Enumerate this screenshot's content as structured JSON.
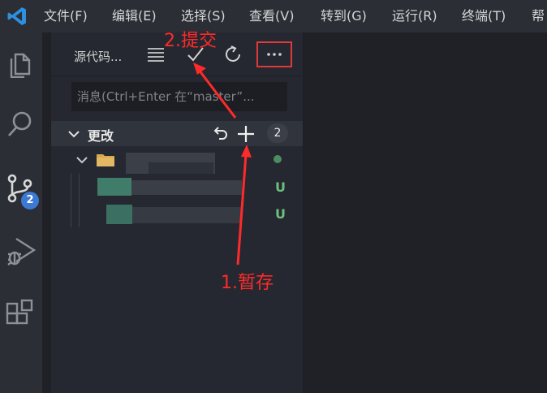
{
  "menu": [
    "文件(F)",
    "编辑(E)",
    "选择(S)",
    "查看(V)",
    "转到(G)",
    "运行(R)",
    "终端(T)",
    "帮"
  ],
  "activity": {
    "source_control_badge": "2"
  },
  "sidebar": {
    "title": "源代码...",
    "commit_message_placeholder": "消息(Ctrl+Enter 在“master”...",
    "changes_label": "更改",
    "changes_count": "2",
    "files": [
      {
        "status": "U"
      },
      {
        "status": "U"
      }
    ]
  },
  "annotations": {
    "commit": "2.提交",
    "stage": "1.暂存"
  },
  "colors": {
    "accent_badge": "#3c79d5",
    "annotation": "#ff2a2a",
    "untracked": "#6cc07e"
  }
}
